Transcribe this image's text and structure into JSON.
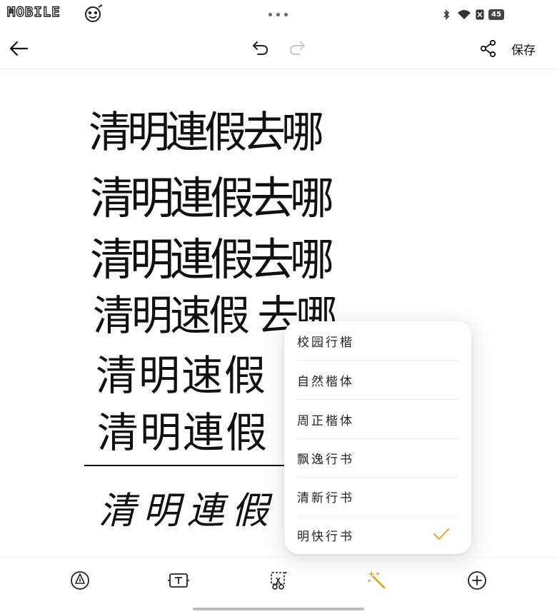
{
  "status_bar": {
    "watermark": "MOBILE",
    "battery_level": "45"
  },
  "header": {
    "save_label": "保存"
  },
  "note": {
    "lines": [
      "清明連假去哪",
      "清明連假去哪",
      "清明連假去哪",
      "清明速假 去哪",
      "清明速假",
      "清明連假",
      "清明連假"
    ]
  },
  "font_menu": {
    "items": [
      {
        "label": "校园行楷"
      },
      {
        "label": "自然楷体"
      },
      {
        "label": "周正楷体"
      },
      {
        "label": "飘逸行书"
      },
      {
        "label": "清新行书"
      },
      {
        "label": "明快行书"
      }
    ],
    "selected": "明快行书"
  },
  "colors": {
    "accent": "#E0A82E",
    "ink": "#111111",
    "disabled": "#C8C8C8"
  },
  "icons": {
    "back": "arrow-left-icon",
    "undo": "undo-icon",
    "redo": "redo-icon",
    "share": "share-icon",
    "pen": "pen-nib-icon",
    "text": "text-box-icon",
    "lasso": "lasso-scissors-icon",
    "beautify": "magic-wand-icon",
    "add": "plus-circle-icon"
  }
}
